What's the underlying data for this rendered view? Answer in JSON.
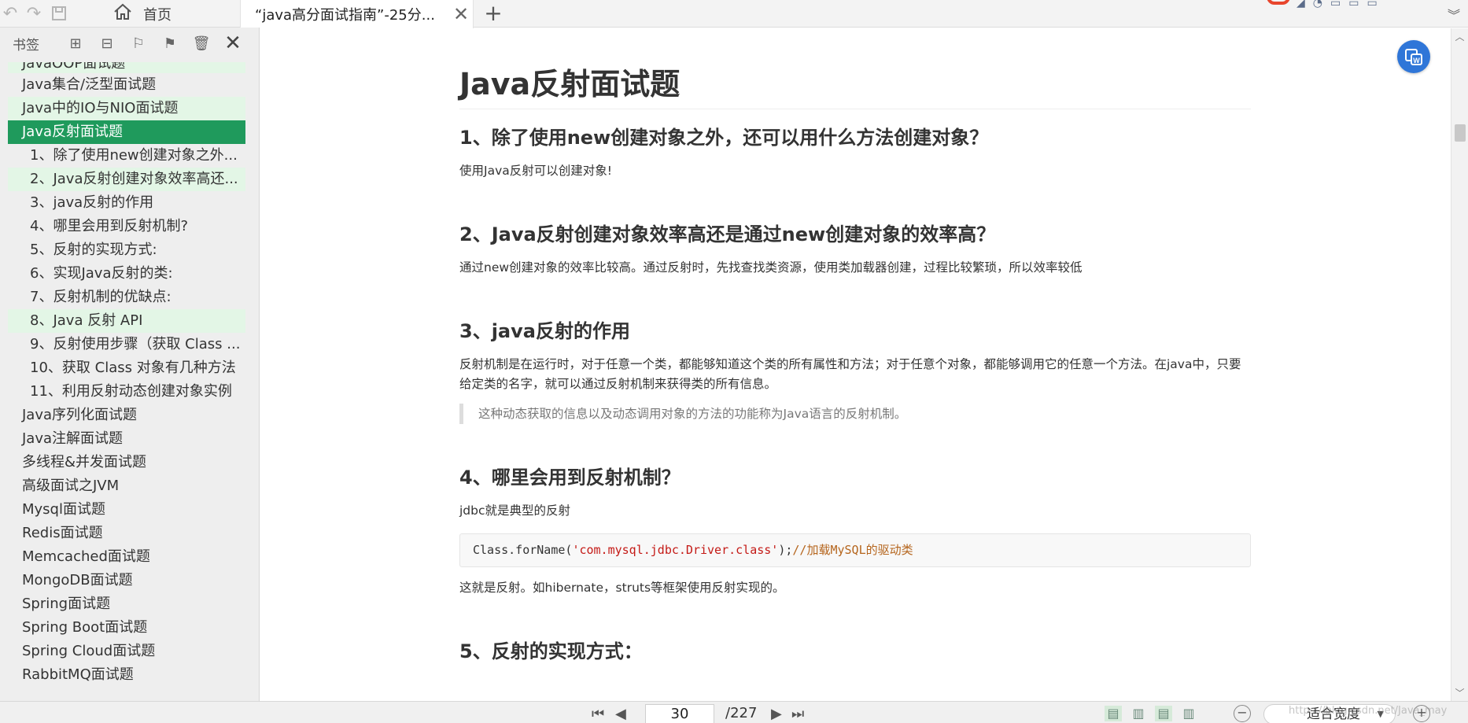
{
  "topbar": {
    "quick_icons": [
      "undo-icon",
      "redo-icon",
      "save-icon"
    ],
    "home_tab_label": "首页",
    "active_tab_title": "“java高分面试指南”-25分...",
    "close_symbol": "✕",
    "new_tab_symbol": "+"
  },
  "sidebar": {
    "title": "书签",
    "outline": [
      {
        "label": "JavaOOP面试题",
        "level": 1,
        "state": "hl-cut"
      },
      {
        "label": "Java集合/泛型面试题",
        "level": 1,
        "state": ""
      },
      {
        "label": "Java中的IO与NIO面试题",
        "level": 1,
        "state": "hl"
      },
      {
        "label": "Java反射面试题",
        "level": 1,
        "state": "sel"
      },
      {
        "label": "1、除了使用new创建对象之外...",
        "level": 2,
        "state": ""
      },
      {
        "label": "2、Java反射创建对象效率高还...",
        "level": 2,
        "state": "hl"
      },
      {
        "label": "3、java反射的作用",
        "level": 2,
        "state": ""
      },
      {
        "label": "4、哪里会用到反射机制?",
        "level": 2,
        "state": ""
      },
      {
        "label": "5、反射的实现方式:",
        "level": 2,
        "state": ""
      },
      {
        "label": "6、实现Java反射的类:",
        "level": 2,
        "state": ""
      },
      {
        "label": "7、反射机制的优缺点:",
        "level": 2,
        "state": ""
      },
      {
        "label": "8、Java 反射 API",
        "level": 2,
        "state": "hl"
      },
      {
        "label": "9、反射使用步骤（获取 Class ...",
        "level": 2,
        "state": ""
      },
      {
        "label": "10、获取 Class 对象有几种方法",
        "level": 2,
        "state": ""
      },
      {
        "label": "11、利用反射动态创建对象实例",
        "level": 2,
        "state": ""
      },
      {
        "label": "Java序列化面试题",
        "level": 1,
        "state": ""
      },
      {
        "label": "Java注解面试题",
        "level": 1,
        "state": ""
      },
      {
        "label": "多线程&并发面试题",
        "level": 1,
        "state": ""
      },
      {
        "label": "高级面试之JVM",
        "level": 1,
        "state": ""
      },
      {
        "label": "Mysql面试题",
        "level": 1,
        "state": ""
      },
      {
        "label": "Redis面试题",
        "level": 1,
        "state": ""
      },
      {
        "label": "Memcached面试题",
        "level": 1,
        "state": ""
      },
      {
        "label": "MongoDB面试题",
        "level": 1,
        "state": ""
      },
      {
        "label": "Spring面试题",
        "level": 1,
        "state": ""
      },
      {
        "label": "Spring Boot面试题",
        "level": 1,
        "state": ""
      },
      {
        "label": "Spring Cloud面试题",
        "level": 1,
        "state": ""
      },
      {
        "label": "RabbitMQ面试题",
        "level": 1,
        "state": ""
      }
    ]
  },
  "document": {
    "h1": "Java反射面试题",
    "q1_title": "1、除了使用new创建对象之外，还可以用什么方法创建对象？",
    "q1_body": "使用Java反射可以创建对象!",
    "q2_title": "2、Java反射创建对象效率高还是通过new创建对象的效率高？",
    "q2_body": "通过new创建对象的效率比较高。通过反射时，先找查找类资源，使用类加载器创建，过程比较繁琐，所以效率较低",
    "q3_title": "3、java反射的作用",
    "q3_body": "反射机制是在运行时，对于任意一个类，都能够知道这个类的所有属性和方法；对于任意个对象，都能够调用它的任意一个方法。在java中，只要给定类的名字，就可以通过反射机制来获得类的所有信息。",
    "q3_quote": "这种动态获取的信息以及动态调用对象的方法的功能称为Java语言的反射机制。",
    "q4_title": "4、哪里会用到反射机制？",
    "q4_body": "jdbc就是典型的反射",
    "q4_code_plain": "Class.forName(",
    "q4_code_str": "'com.mysql.jdbc.Driver.class'",
    "q4_code_end": ");",
    "q4_code_comment": "//加载MySQL的驱动类",
    "q4_after": "这就是反射。如hibernate，struts等框架使用反射实现的。",
    "q5_title": "5、反射的实现方式："
  },
  "floating_button_icon": "translate-icon",
  "statusbar": {
    "current_page": "30",
    "total_pages": "/227",
    "zoom_label": "适合宽度",
    "watermark": "https://blog.csdn.net/Java_may"
  },
  "colors": {
    "selected_bg": "#1f9a5c",
    "highlight_bg": "#e3f6e6",
    "accent_blue": "#2f76d8",
    "code_string": "#c41a16",
    "code_comment": "#b5651d"
  }
}
